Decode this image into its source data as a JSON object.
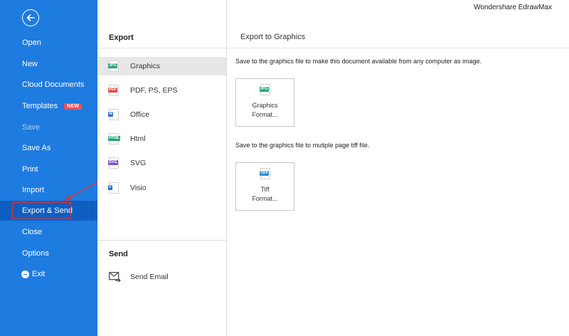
{
  "app": {
    "title": "Wondershare EdrawMax"
  },
  "sidebar": {
    "items": [
      {
        "label": "Open"
      },
      {
        "label": "New"
      },
      {
        "label": "Cloud Documents"
      },
      {
        "label": "Templates",
        "badge": "NEW"
      },
      {
        "label": "Save",
        "disabled": true
      },
      {
        "label": "Save As"
      },
      {
        "label": "Print"
      },
      {
        "label": "Import"
      },
      {
        "label": "Export & Send",
        "active": true
      },
      {
        "label": "Close"
      },
      {
        "label": "Options"
      },
      {
        "label": "Exit"
      }
    ]
  },
  "export_panel": {
    "heading": "Export",
    "items": [
      {
        "label": "Graphics",
        "tag": "JPG",
        "tag_color": "#2aa37a"
      },
      {
        "label": "PDF, PS, EPS",
        "tag": "PDF",
        "tag_color": "#e64646"
      },
      {
        "label": "Office",
        "tag": "W",
        "tag_color": "#2f6fd6"
      },
      {
        "label": "Html",
        "tag": "HTML",
        "tag_color": "#2aa37a"
      },
      {
        "label": "SVG",
        "tag": "SVG",
        "tag_color": "#7a55c8"
      },
      {
        "label": "Visio",
        "tag": "V",
        "tag_color": "#2f6fd6"
      }
    ]
  },
  "send_panel": {
    "heading": "Send",
    "items": [
      {
        "label": "Send Email"
      }
    ]
  },
  "content": {
    "title": "Export to Graphics",
    "sections": [
      {
        "description": "Save to the graphics file to make this document available from any computer as image.",
        "button_line1": "Graphics",
        "button_line2": "Format...",
        "tag": "JPG",
        "tag_color": "#2aa37a"
      },
      {
        "description": "Save to the graphics file to mutiple page tiff file.",
        "button_line1": "Tiff",
        "button_line2": "Format...",
        "tag": "TIFF",
        "tag_color": "#2f8fd6"
      }
    ]
  }
}
